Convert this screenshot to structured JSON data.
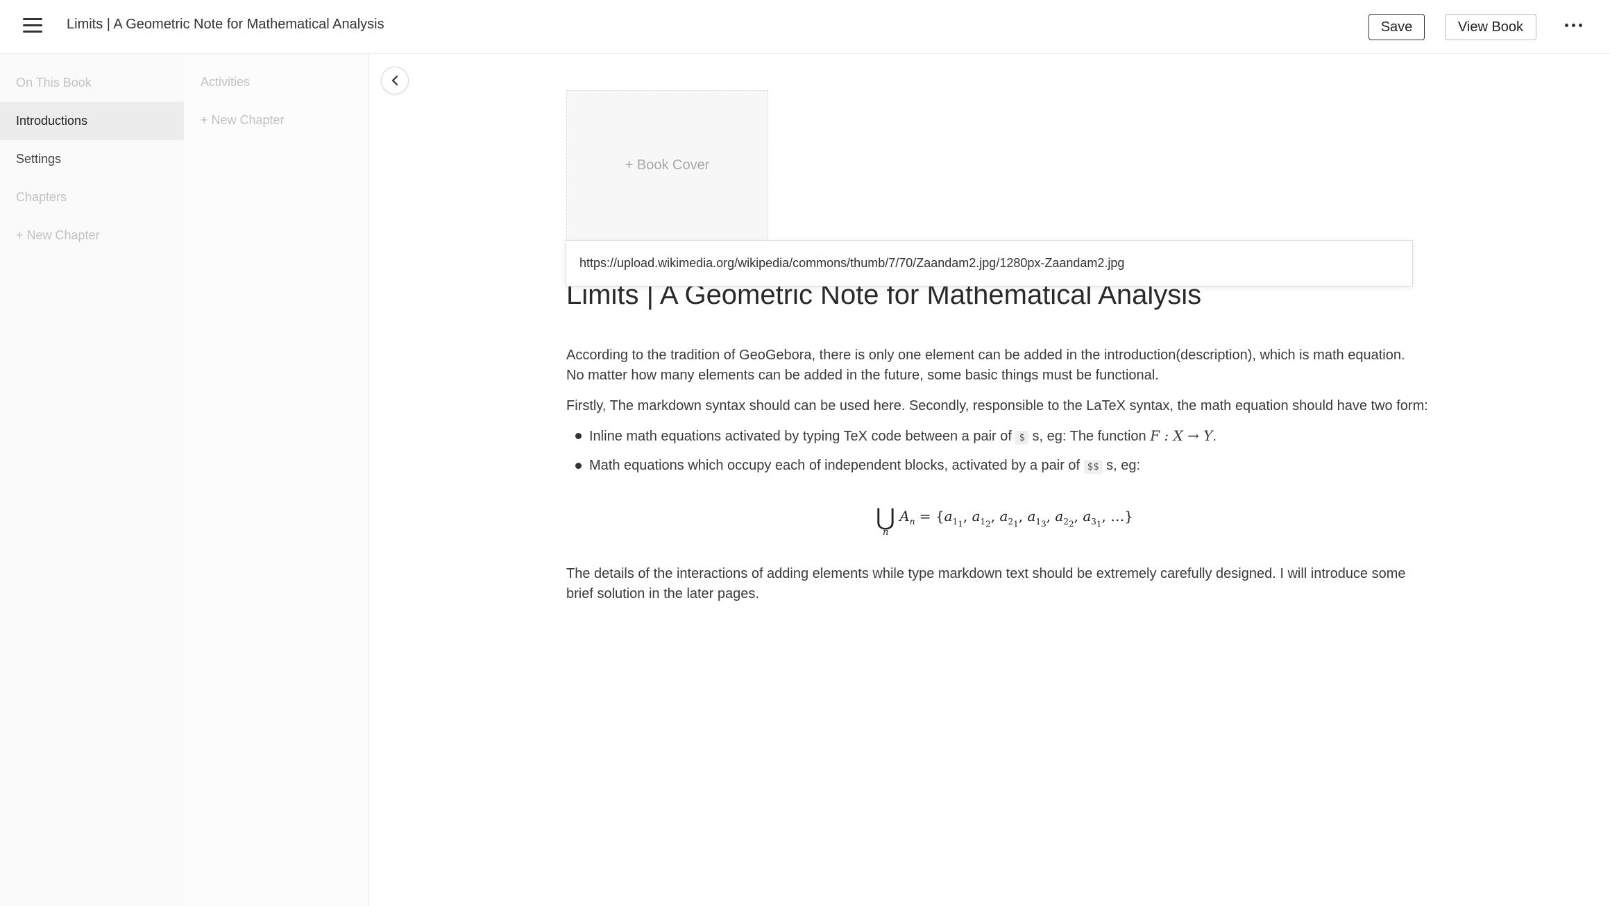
{
  "header": {
    "title": "Limits | A Geometric Note for Mathematical Analysis",
    "save_label": "Save",
    "view_book_label": "View Book",
    "menu_icon": "hamburger-menu-icon",
    "more_icon": "more-horizontal-icon"
  },
  "sidebar": {
    "items": [
      {
        "label": "On This Book"
      },
      {
        "label": "Introductions"
      },
      {
        "label": "Settings"
      },
      {
        "label": "Chapters"
      },
      {
        "label": "+ New Chapter"
      }
    ]
  },
  "subsidebar": {
    "items": [
      {
        "label": "Activities"
      },
      {
        "label": "+ New Chapter"
      }
    ]
  },
  "main": {
    "book_cover_label": "+ Book Cover",
    "cover_url": "https://upload.wikimedia.org/wikipedia/commons/thumb/7/70/Zaandam2.jpg/1280px-Zaandam2.jpg",
    "title": "Limits | A Geometric Note for Mathematical Analysis",
    "p1_line1": "According to the tradition of GeoGebora, there is only one element can be added in the introduction(description), which is math equation.",
    "p1_line2": "No matter how many elements can be added in the future, some basic things must be functional.",
    "p2": "Firstly, The markdown syntax should can be used here. Secondly, responsible to the LaTeX syntax, the math equation should have two form:",
    "bullet1_a": "Inline math equations activated by typing TeX code between a pair of",
    "bullet1_code": "$",
    "bullet1_b": "s, eg: The function",
    "bullet1_math": "F : X → Y",
    "bullet1_end": ".",
    "bullet2_a": "Math equations which occupy each of independent blocks, activated by a pair of",
    "bullet2_code": "$$",
    "bullet2_b": "s, eg:",
    "p3_line1": "The details of the interactions of adding elements while type markdown text should be extremely carefully designed. I will introduce some",
    "p3_line2": "brief solution in the later pages."
  },
  "colors": {
    "sidebar_bg": "#fafafa",
    "active_item_bg": "#ececec",
    "muted_text": "#c2c2c2"
  }
}
